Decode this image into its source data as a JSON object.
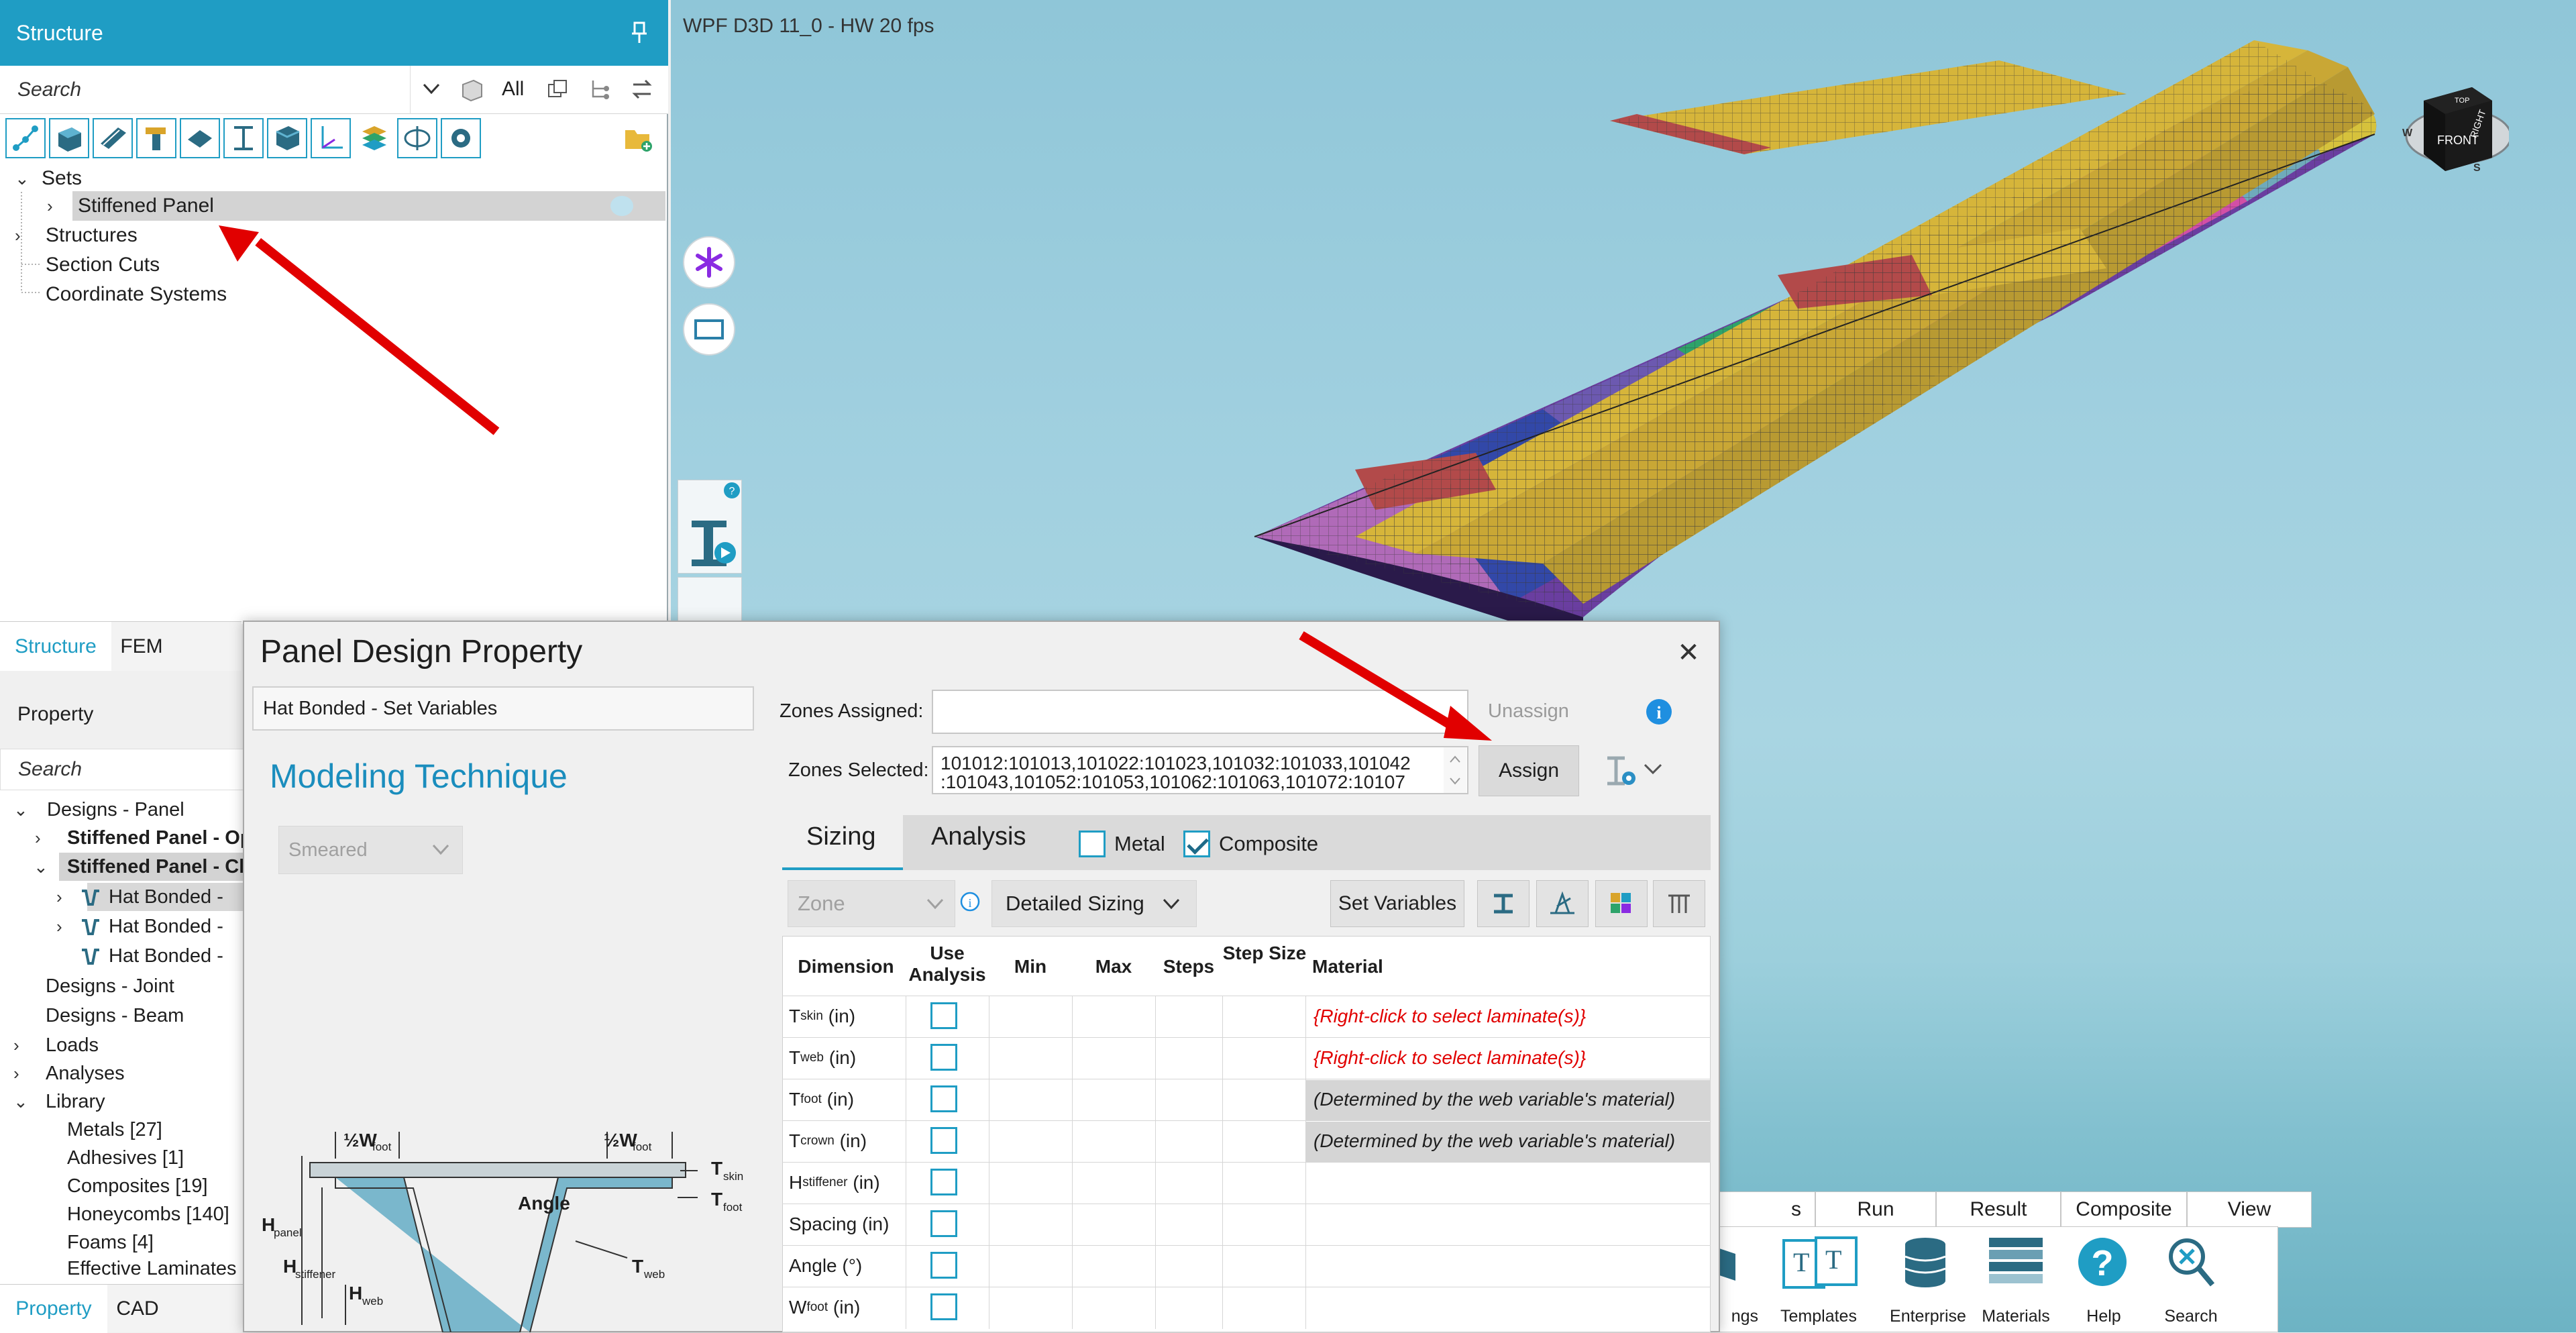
{
  "viewport": {
    "title": "WPF D3D 11_0 - HW  20 fps",
    "viewcube": {
      "face_front": "FRONT",
      "face_right": "RIGHT",
      "face_top": "TOP",
      "compass_w": "W",
      "compass_s": "S"
    }
  },
  "structure_panel": {
    "title": "Structure",
    "search_placeholder": "Search",
    "all_label": "All",
    "tree": [
      {
        "label": "Sets"
      },
      {
        "label": "Stiffened Panel"
      },
      {
        "label": "Structures"
      },
      {
        "label": "Section Cuts"
      },
      {
        "label": "Coordinate Systems"
      }
    ]
  },
  "left_tabs": [
    {
      "label": "Structure"
    },
    {
      "label": "FEM"
    }
  ],
  "property_panel": {
    "header": "Property",
    "search_placeholder": "Search",
    "tree": [
      {
        "label": "Designs - Panel"
      },
      {
        "label": "Stiffened Panel - Op"
      },
      {
        "label": "Stiffened Panel - Cl"
      },
      {
        "label": "Hat Bonded -"
      },
      {
        "label": "Hat Bonded -"
      },
      {
        "label": "Hat Bonded -"
      },
      {
        "label": "Designs - Joint"
      },
      {
        "label": "Designs - Beam"
      },
      {
        "label": "Loads"
      },
      {
        "label": "Analyses"
      },
      {
        "label": "Library"
      },
      {
        "label": "Metals",
        "count": "[27]"
      },
      {
        "label": "Adhesives",
        "count": "[1]"
      },
      {
        "label": "Composites",
        "count": "[19]"
      },
      {
        "label": "Honeycombs",
        "count": "[140]"
      },
      {
        "label": "Foams",
        "count": "[4]"
      },
      {
        "label": "Effective Laminates"
      }
    ]
  },
  "bottom_tabs": [
    {
      "label": "Property"
    },
    {
      "label": "CAD"
    }
  ],
  "ribbon": {
    "tabs": [
      "s",
      "Run",
      "Result",
      "Composite",
      "View"
    ],
    "buttons": [
      "ngs",
      "Templates",
      "Enterprise",
      "Materials",
      "Help",
      "Search"
    ]
  },
  "dialog": {
    "title": "Panel Design Property",
    "design_name": "Hat Bonded - Set Variables",
    "modeling_technique_label": "Modeling Technique",
    "modeling_technique_value": "Smeared",
    "zones_assigned_label": "Zones Assigned:",
    "zones_assigned_value": "",
    "zones_selected_label": "Zones Selected:",
    "zones_selected_line1": "101012:101013,101022:101023,101032:101033,101042",
    "zones_selected_line2": ":101043,101052:101053,101062:101063,101072:10107",
    "unassign_label": "Unassign",
    "assign_label": "Assign",
    "tabs": [
      "Sizing",
      "Analysis"
    ],
    "metal_label": "Metal",
    "metal_checked": false,
    "composite_label": "Composite",
    "composite_checked": true,
    "zone_dropdown": "Zone",
    "sizing_mode": "Detailed Sizing",
    "set_variables_label": "Set Variables",
    "grid_headers": [
      "Dimension",
      "Use Analysis",
      "Min",
      "Max",
      "Steps",
      "Step Size",
      "Material"
    ],
    "grid_rows": [
      {
        "main": "T",
        "sub": "skin",
        "unit": " (in)",
        "material": "{Right-click to select laminate(s)}",
        "material_color": "#e10000",
        "shaded": false
      },
      {
        "main": "T",
        "sub": "web",
        "unit": " (in)",
        "material": "{Right-click to select laminate(s)}",
        "material_color": "#e10000",
        "shaded": false
      },
      {
        "main": "T",
        "sub": "foot",
        "unit": " (in)",
        "material": "(Determined by the web variable's material)",
        "material_color": "#1e1e1e",
        "shaded": true
      },
      {
        "main": "T",
        "sub": "crown",
        "unit": " (in)",
        "material": "(Determined by the web variable's material)",
        "material_color": "#1e1e1e",
        "shaded": true
      },
      {
        "main": "H",
        "sub": "stiffener",
        "unit": " (in)",
        "material": "",
        "material_color": "#1e1e1e",
        "shaded": false
      },
      {
        "main": "Spacing",
        "sub": "",
        "unit": " (in)",
        "material": "",
        "material_color": "#1e1e1e",
        "shaded": false
      },
      {
        "main": "Angle",
        "sub": "",
        "unit": " (°)",
        "material": "",
        "material_color": "#1e1e1e",
        "shaded": false
      },
      {
        "main": "W",
        "sub": "foot",
        "unit": " (in)",
        "material": "",
        "material_color": "#1e1e1e",
        "shaded": false
      }
    ],
    "diagram": {
      "labels": [
        "½W",
        "foot",
        "½W",
        "foot",
        "T",
        "skin",
        "T",
        "foot",
        "H",
        "panel",
        "H",
        "stiffener",
        "H",
        "web",
        "Angle",
        "T",
        "web"
      ]
    }
  },
  "colors": {
    "accent": "#1f9dc4",
    "arrow": "#e10000",
    "link": "#1a8dbd"
  }
}
